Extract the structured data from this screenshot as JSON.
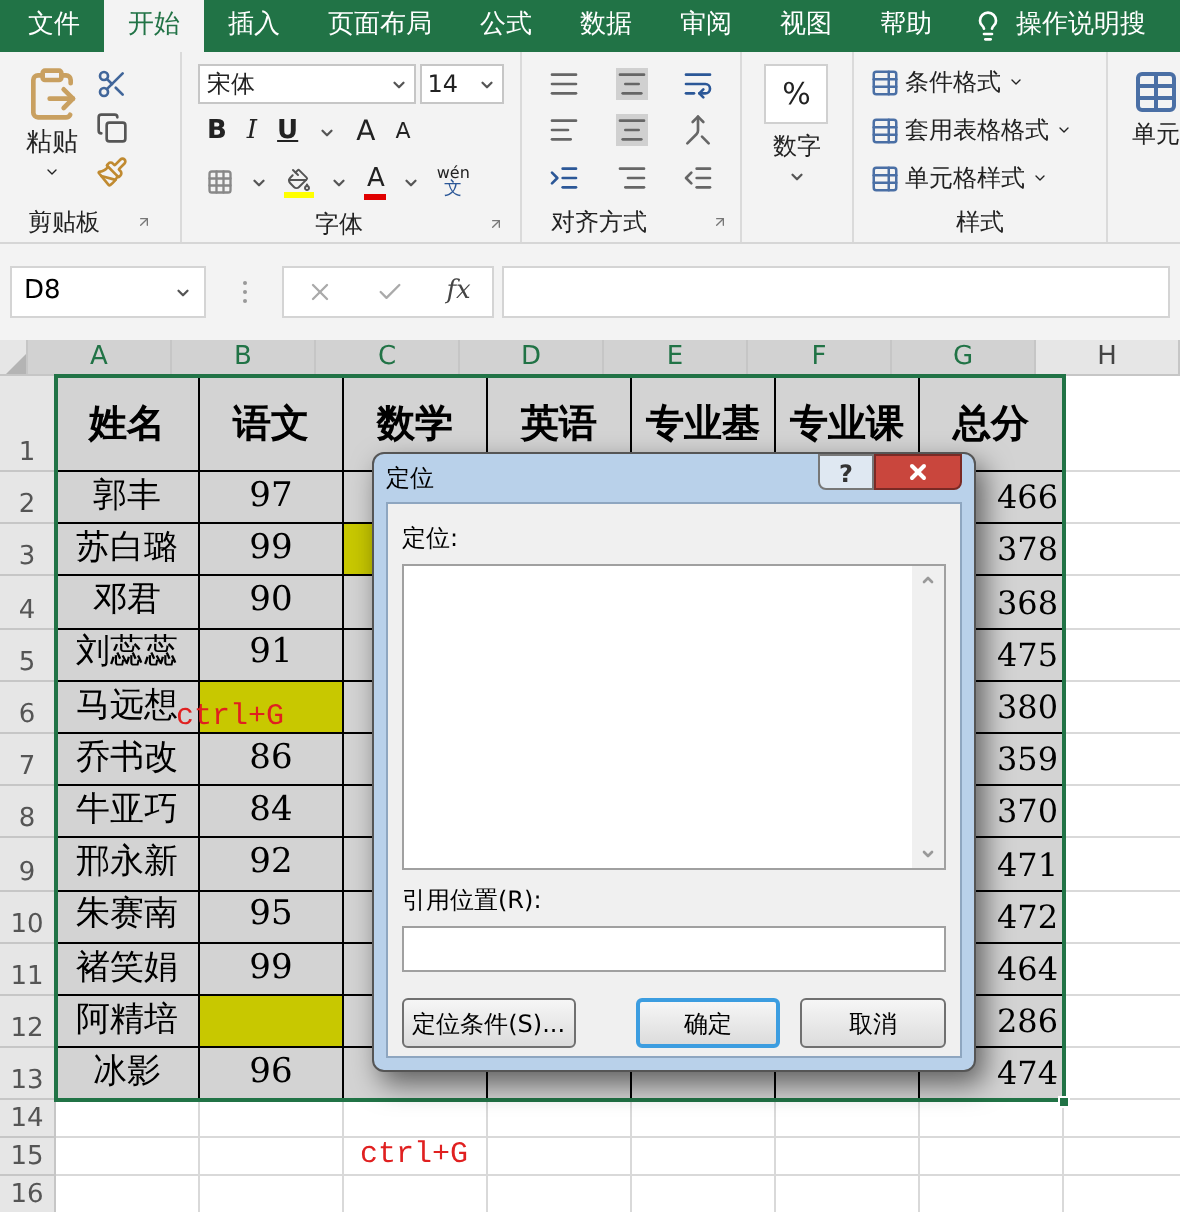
{
  "ribbon": {
    "tabs": [
      {
        "label": "文件",
        "selected": false
      },
      {
        "label": "开始",
        "selected": true
      },
      {
        "label": "插入",
        "selected": false
      },
      {
        "label": "页面布局",
        "selected": false
      },
      {
        "label": "公式",
        "selected": false
      },
      {
        "label": "数据",
        "selected": false
      },
      {
        "label": "审阅",
        "selected": false
      },
      {
        "label": "视图",
        "selected": false
      },
      {
        "label": "帮助",
        "selected": false
      }
    ],
    "tell_me": "操作说明搜",
    "clipboard": {
      "paste": "粘贴",
      "label": "剪贴板"
    },
    "font": {
      "name": "宋体",
      "size": "14",
      "bold": "B",
      "italic": "I",
      "underline": "U",
      "grow": "A",
      "shrink": "A",
      "font_color": "A",
      "phonetic_top": "wén",
      "phonetic_bottom": "文",
      "label": "字体"
    },
    "alignment": {
      "label": "对齐方式"
    },
    "number": {
      "symbol": "%",
      "button": "数字"
    },
    "styles": {
      "items": [
        "条件格式",
        "套用表格格式",
        "单元格样式"
      ],
      "label": "样式"
    },
    "cells": {
      "button": "单元"
    }
  },
  "formula_bar": {
    "name_box": "D8",
    "fx": "fx"
  },
  "sheet": {
    "columns": [
      {
        "label": "A",
        "selected": true
      },
      {
        "label": "B",
        "selected": true
      },
      {
        "label": "C",
        "selected": true
      },
      {
        "label": "D",
        "selected": true
      },
      {
        "label": "E",
        "selected": true
      },
      {
        "label": "F",
        "selected": true
      },
      {
        "label": "G",
        "selected": true
      },
      {
        "label": "H",
        "selected": false
      }
    ],
    "rows": [
      {
        "number": "1",
        "cells": [
          {
            "text": "姓名",
            "highlighted": false
          },
          {
            "text": "语文",
            "highlighted": false
          },
          {
            "text": "数学",
            "highlighted": false
          },
          {
            "text": "英语",
            "highlighted": false
          },
          {
            "text": "专业基",
            "highlighted": false
          },
          {
            "text": "专业课",
            "highlighted": false
          },
          {
            "text": "总分",
            "highlighted": false
          }
        ]
      },
      {
        "number": "2",
        "cells": [
          {
            "text": "郭丰",
            "highlighted": false
          },
          {
            "text": "97",
            "highlighted": false
          },
          {
            "highlighted": false
          },
          {},
          {},
          {},
          {
            "text": "466",
            "highlighted": false
          }
        ]
      },
      {
        "number": "3",
        "cells": [
          {
            "text": "苏白璐",
            "highlighted": false
          },
          {
            "text": "99",
            "highlighted": false
          },
          {
            "highlighted": true
          },
          {},
          {},
          {},
          {
            "text": "378",
            "highlighted": false
          }
        ]
      },
      {
        "number": "4",
        "cells": [
          {
            "text": "邓君",
            "highlighted": false
          },
          {
            "text": "90",
            "highlighted": false
          },
          {
            "highlighted": false
          },
          {},
          {},
          {},
          {
            "text": "368",
            "highlighted": false
          }
        ]
      },
      {
        "number": "5",
        "cells": [
          {
            "text": "刘蕊蕊",
            "highlighted": false
          },
          {
            "text": "91",
            "highlighted": false
          },
          {
            "highlighted": false
          },
          {},
          {},
          {},
          {
            "text": "475",
            "highlighted": false
          }
        ]
      },
      {
        "number": "6",
        "cells": [
          {
            "text": "马远想",
            "highlighted": false
          },
          {
            "highlighted": true
          },
          {
            "highlighted": false
          },
          {},
          {},
          {},
          {
            "text": "380",
            "highlighted": false
          }
        ]
      },
      {
        "number": "7",
        "cells": [
          {
            "text": "乔书改",
            "highlighted": false
          },
          {
            "text": "86",
            "highlighted": false
          },
          {
            "highlighted": false
          },
          {},
          {},
          {},
          {
            "text": "359",
            "highlighted": false
          }
        ]
      },
      {
        "number": "8",
        "cells": [
          {
            "text": "牛亚巧",
            "highlighted": false
          },
          {
            "text": "84",
            "highlighted": false
          },
          {
            "highlighted": false
          },
          {},
          {},
          {},
          {
            "text": "370",
            "highlighted": false
          }
        ]
      },
      {
        "number": "9",
        "cells": [
          {
            "text": "邢永新",
            "highlighted": false
          },
          {
            "text": "92",
            "highlighted": false
          },
          {
            "highlighted": false
          },
          {},
          {},
          {},
          {
            "text": "471",
            "highlighted": false
          }
        ]
      },
      {
        "number": "10",
        "cells": [
          {
            "text": "朱赛南",
            "highlighted": false
          },
          {
            "text": "95",
            "highlighted": false
          },
          {
            "highlighted": false
          },
          {},
          {},
          {},
          {
            "text": "472",
            "highlighted": false
          }
        ]
      },
      {
        "number": "11",
        "cells": [
          {
            "text": "褚笑娟",
            "highlighted": false
          },
          {
            "text": "99",
            "highlighted": false
          },
          {
            "highlighted": false
          },
          {},
          {},
          {},
          {
            "text": "464",
            "highlighted": false
          }
        ]
      },
      {
        "number": "12",
        "cells": [
          {
            "text": "阿精培",
            "highlighted": false
          },
          {
            "highlighted": true
          },
          {
            "highlighted": false
          },
          {},
          {},
          {},
          {
            "text": "286",
            "highlighted": false
          }
        ]
      },
      {
        "number": "13",
        "cells": [
          {
            "text": "冰影",
            "highlighted": false
          },
          {
            "text": "96",
            "highlighted": false
          },
          {
            "highlighted": false
          },
          {
            "highlighted": false
          },
          {
            "highlighted": false
          },
          {
            "highlighted": false
          },
          {
            "text": "474",
            "highlighted": false
          }
        ]
      },
      {
        "number": "14",
        "cells": []
      },
      {
        "number": "15",
        "cells": [
          {},
          {},
          {
            "text": "ctrl+G",
            "kind": "annotation"
          }
        ]
      },
      {
        "number": "16",
        "cells": []
      }
    ],
    "annotations": [
      "ctrl+G"
    ]
  },
  "dialog": {
    "title": "定位",
    "help": "?",
    "list_label": "定位:",
    "reference_label": "引用位置(R):",
    "buttons": [
      {
        "label": "定位条件(S)...",
        "default": false
      },
      {
        "label": "确定",
        "default": true
      },
      {
        "label": "取消",
        "default": false
      }
    ]
  }
}
